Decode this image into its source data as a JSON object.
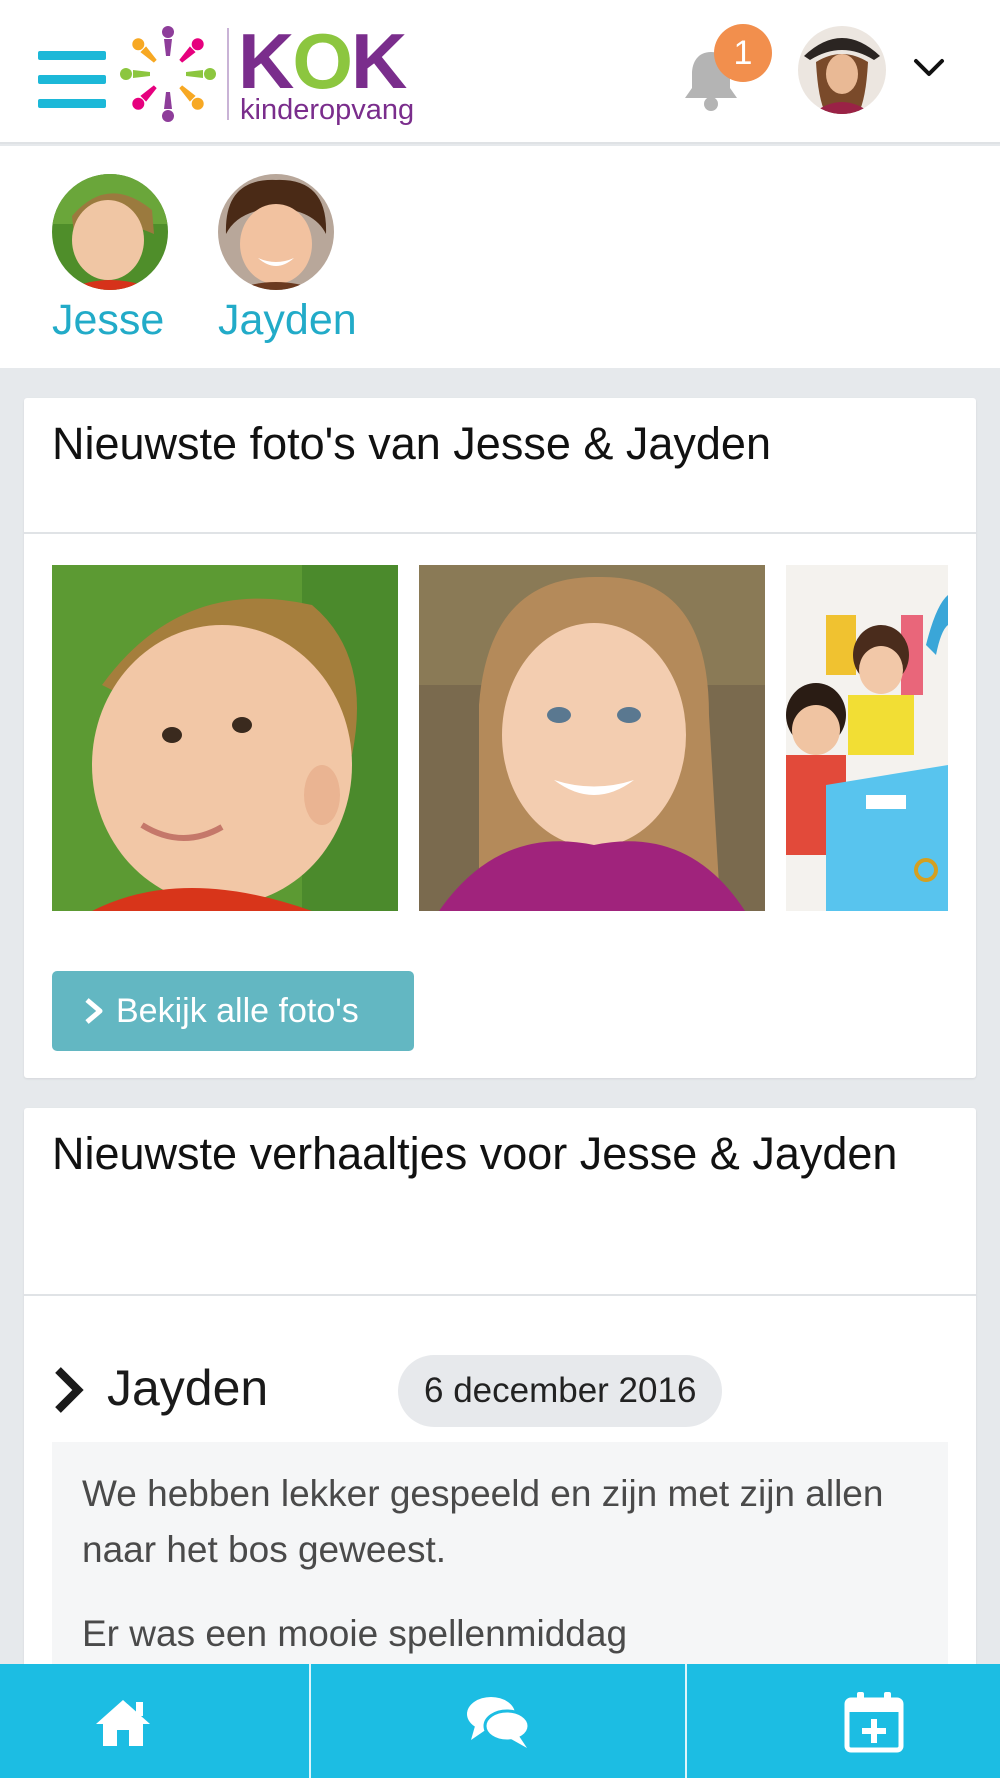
{
  "header": {
    "logo_text": "KOK",
    "logo_sub": "kinderopvang",
    "notification_count": "1"
  },
  "children": [
    {
      "name": "Jesse"
    },
    {
      "name": "Jayden"
    }
  ],
  "photos": {
    "title": "Nieuwste foto's van Jesse & Jayden",
    "button_label": "Bekijk alle foto's"
  },
  "stories": {
    "title": "Nieuwste verhaaltjes voor Jesse & Jayden",
    "items": [
      {
        "child": "Jayden",
        "date": "6 december 2016",
        "paragraphs": [
          "We hebben lekker gespeeld en zijn met zijn allen naar het bos geweest.",
          "Er was een mooie spellenmiddag"
        ]
      }
    ]
  },
  "bottom_nav": [
    {
      "icon": "home-icon"
    },
    {
      "icon": "chat-icon"
    },
    {
      "icon": "calendar-add-icon"
    }
  ],
  "colors": {
    "accent": "#1cbde3",
    "child_name": "#22abc8",
    "button": "#63b7c2",
    "badge": "#f28f4d",
    "logo_purple": "#7a2d8c",
    "logo_green": "#8cc63f"
  }
}
